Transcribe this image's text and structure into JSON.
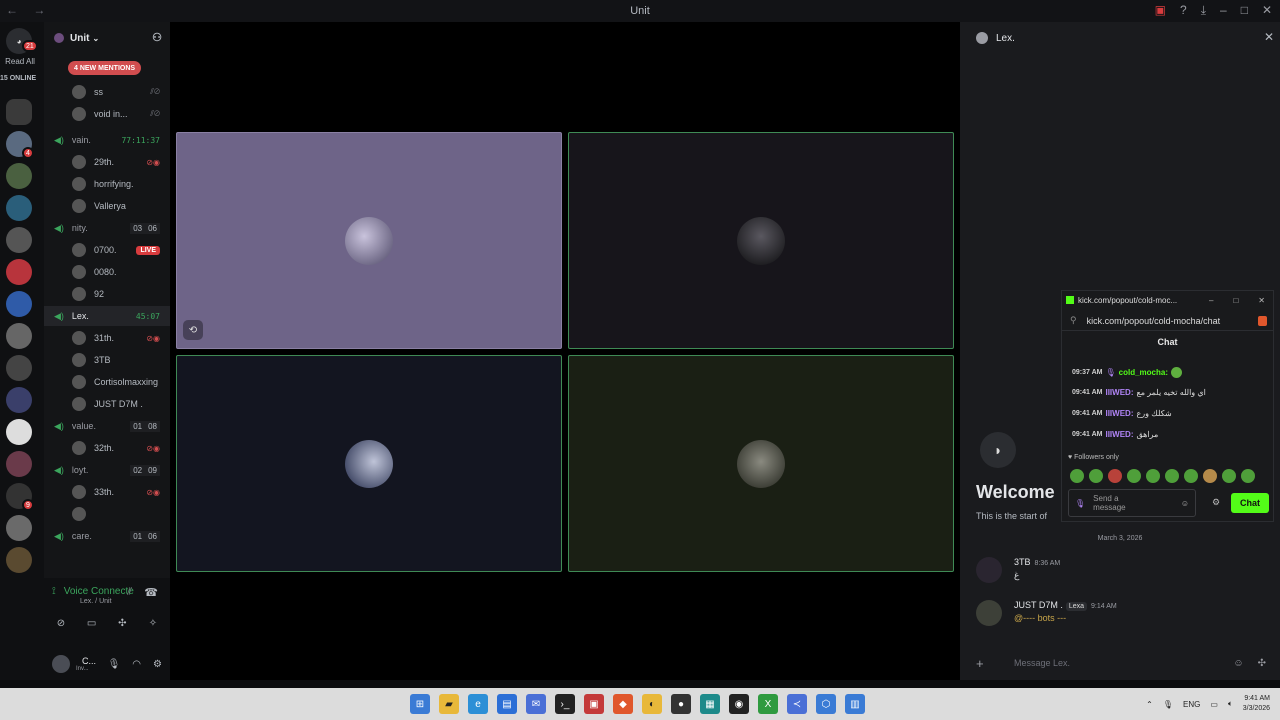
{
  "window": {
    "title": "Unit",
    "nav": "← →"
  },
  "guild_bar": {
    "home_badge": "21",
    "read_all": "Read All",
    "online": "15 ONLINE",
    "guild_badges": [
      "",
      "4",
      "",
      "",
      "",
      "",
      "",
      "",
      "",
      "",
      "",
      "",
      "9",
      "",
      ""
    ]
  },
  "server": {
    "name": "Unit",
    "new_mentions": "4 NEW MENTIONS",
    "top_users": [
      {
        "name": "ss"
      },
      {
        "name": "void in..."
      }
    ],
    "voice_channels": [
      {
        "name": "vain.",
        "timer": "77:11:37",
        "users": [
          {
            "name": "29th.",
            "icon": "◉"
          },
          {
            "name": "horrifying.",
            "icon": ""
          },
          {
            "name": "Vallerya",
            "icon": ""
          }
        ]
      },
      {
        "name": "nity.",
        "count_a": "03",
        "count_b": "06",
        "users": [
          {
            "name": "0700.",
            "live": "LIVE"
          },
          {
            "name": "0080.",
            "icon": ""
          },
          {
            "name": "92",
            "icon": ""
          }
        ]
      },
      {
        "name": "Lex.",
        "timer": "45:07",
        "users": [
          {
            "name": "31th.",
            "icon": "◉"
          },
          {
            "name": "3TB",
            "icon": ""
          },
          {
            "name": "Cortisolmaxxing",
            "icon": ""
          },
          {
            "name": "JUST D7M .",
            "icon": ""
          }
        ]
      },
      {
        "name": "value.",
        "count_a": "01",
        "count_b": "08",
        "users": [
          {
            "name": "32th.",
            "icon": "◉"
          }
        ]
      },
      {
        "name": "loyt.",
        "count_a": "02",
        "count_b": "09",
        "users": [
          {
            "name": "33th.",
            "icon": "◉"
          },
          {
            "name": "",
            "icon": ""
          }
        ]
      },
      {
        "name": "care.",
        "count_a": "01",
        "count_b": "06",
        "users": []
      }
    ],
    "voice_panel": {
      "status": "Voice Connecte",
      "location": "Lex. / Unit"
    },
    "user": {
      "name": "C...",
      "status": "Inv..."
    }
  },
  "right_panel": {
    "title": "Lex.",
    "welcome": "Welcome",
    "welcome_sub": "This is the start of",
    "date_divider": "March 3, 2026",
    "messages": [
      {
        "author": "3TB",
        "time": "8:36 AM",
        "text": "غ"
      },
      {
        "author": "JUST D7M .",
        "tag": "Lexa",
        "time": "9:14 AM",
        "text": "@---- bots ---"
      }
    ],
    "composer_placeholder": "Message Lex."
  },
  "kick_popout": {
    "window_title": "kick.com/popout/cold-moc...",
    "url": "kick.com/popout/cold-mocha/chat",
    "chat_title": "Chat",
    "messages": [
      {
        "time": "09:37 AM",
        "user": "cold_mocha:",
        "text": ""
      },
      {
        "time": "09:41 AM",
        "user": "IIIWED:",
        "text": "اي والله تخيه يلمر مع"
      },
      {
        "time": "09:41 AM",
        "user": "IIIWED:",
        "text": "شكلك ورع"
      },
      {
        "time": "09:41 AM",
        "user": "IIIWED:",
        "text": "مراهق"
      }
    ],
    "followers_only": "Followers only",
    "input_placeholder": "Send a message",
    "chat_button": "Chat"
  },
  "taskbar": {
    "language": "ENG",
    "time": "9:41 AM",
    "date": "3/3/2026"
  },
  "colors": {
    "speaking_green": "#3ba55d",
    "mention_red": "#d14d4f",
    "kick_green": "#53fc18",
    "tile_1": "#6e6488",
    "tile_2": "#17151b",
    "tile_3": "#131520",
    "tile_4": "#1a1f14"
  }
}
